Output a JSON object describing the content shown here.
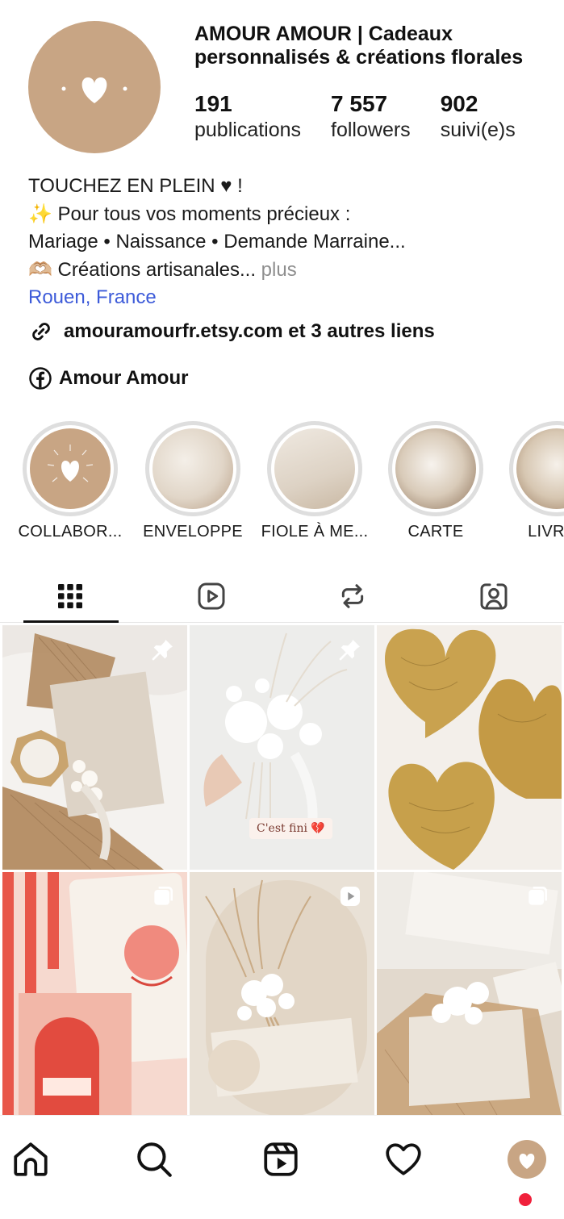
{
  "profile": {
    "name": "AMOUR AMOUR | Cadeaux personnalisés & créations florales",
    "stats": [
      {
        "value": "191",
        "label": "publications"
      },
      {
        "value": "7 557",
        "label": "followers"
      },
      {
        "value": "902",
        "label": "suivi(e)s"
      }
    ],
    "bio": {
      "line1": "TOUCHEZ EN PLEIN ♥ !",
      "line2": "✨ Pour tous vos moments précieux :",
      "line3": "Mariage • Naissance • Demande Marraine...",
      "line4": "🫶🏼 Créations artisanales...",
      "more": "plus",
      "location": "Rouen, France"
    },
    "link_text": "amouramourfr.etsy.com et 3 autres liens",
    "facebook_text": "Amour Amour"
  },
  "highlights": [
    {
      "label": "COLLABOR..."
    },
    {
      "label": "ENVELOPPE"
    },
    {
      "label": "FIOLE À ME..."
    },
    {
      "label": "CARTE"
    },
    {
      "label": "LIVRET"
    }
  ],
  "tabs": [
    {
      "icon": "grid-icon",
      "active": true
    },
    {
      "icon": "reels-icon",
      "active": false
    },
    {
      "icon": "reposts-icon",
      "active": false
    },
    {
      "icon": "tagged-icon",
      "active": false
    }
  ],
  "posts": [
    {
      "badge": "pin-icon",
      "caption": ""
    },
    {
      "badge": "pin-icon",
      "caption": "C'est fini 💔"
    },
    {
      "badge": "",
      "caption": ""
    },
    {
      "badge": "carousel-icon",
      "caption": ""
    },
    {
      "badge": "reel-icon",
      "caption": ""
    },
    {
      "badge": "carousel-icon",
      "caption": ""
    }
  ],
  "bottom_nav": [
    "home-icon",
    "search-icon",
    "reels-icon",
    "heart-icon",
    "profile-avatar"
  ],
  "colors": {
    "accent_beige": "#c8a584",
    "link_blue": "#3d5bd9",
    "notification_red": "#f0203b"
  }
}
